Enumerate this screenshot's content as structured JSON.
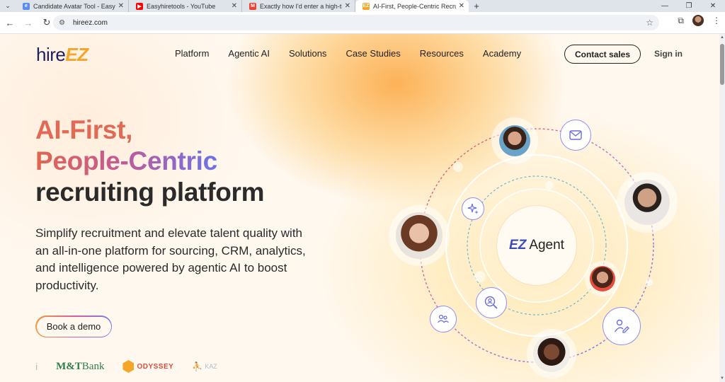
{
  "browser": {
    "tabs": [
      {
        "title": "Candidate Avatar Tool - Easy Hi",
        "fav": "hireez-icon",
        "color": "#5b8def"
      },
      {
        "title": "Easyhiretools - YouTube",
        "fav": "youtube-icon",
        "color": "#ff0000"
      },
      {
        "title": "Exactly how I'd enter a high-tick",
        "fav": "gmail-icon",
        "color": "#ea4335"
      },
      {
        "title": "AI-First, People-Centric Recruiti",
        "fav": "ez-icon",
        "color": "#f4a52a",
        "active": true
      }
    ],
    "url": "hireez.com"
  },
  "header": {
    "logo": {
      "hire": "hire",
      "ez": "EZ"
    },
    "nav": [
      "Platform",
      "Agentic AI",
      "Solutions",
      "Case Studies",
      "Resources",
      "Academy"
    ],
    "contact_label": "Contact sales",
    "signin_label": "Sign in"
  },
  "hero": {
    "line1": "AI-First,",
    "line2": "People-Centric",
    "line3": "recruiting platform",
    "subtitle": "Simplify recruitment and elevate talent quality with an all-in-one platform for sourcing, CRM, analytics, and intelligence powered by agentic AI to boost productivity.",
    "cta_label": "Book a demo"
  },
  "logos": {
    "first": "i",
    "mt": {
      "bold": "M&T",
      "rest": "Bank"
    },
    "odyssey": "ODYSSEY",
    "kaz": "KAZ"
  },
  "graphic": {
    "center": {
      "ez": "EZ",
      "agent": "Agent"
    }
  },
  "colors": {
    "brand_orange": "#f4a52a",
    "brand_navy": "#1f1f5c",
    "accent_purple": "#6b73e8"
  }
}
